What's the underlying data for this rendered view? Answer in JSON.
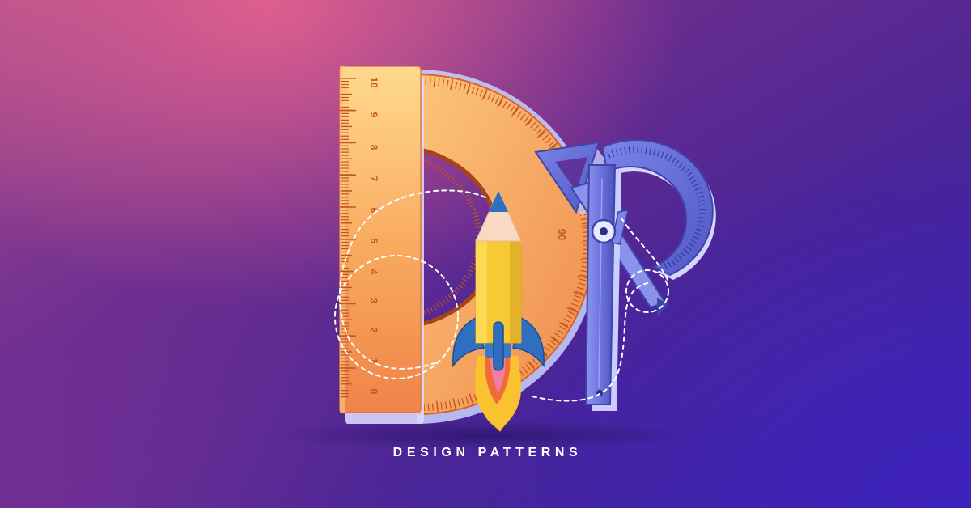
{
  "banner": {
    "title": "DESIGN PATTERNS",
    "ruler_numbers": [
      "10",
      "9",
      "8",
      "7",
      "6",
      "5",
      "4",
      "3",
      "2",
      "1",
      "0"
    ],
    "protractor_label": "90",
    "colors": {
      "background_top": "#d45f8c",
      "background_bottom": "#3b25aa",
      "ruler": "#f49a52",
      "ruler_marks": "#c4561f",
      "blue_tools": "#6e73dc",
      "pencil": "#f7c934",
      "rocket": "#2f6fc0",
      "flame": "#f9c22e"
    },
    "icons": [
      "ruler-icon",
      "protractor-icon",
      "compass-icon",
      "pencil-rocket-icon"
    ]
  }
}
